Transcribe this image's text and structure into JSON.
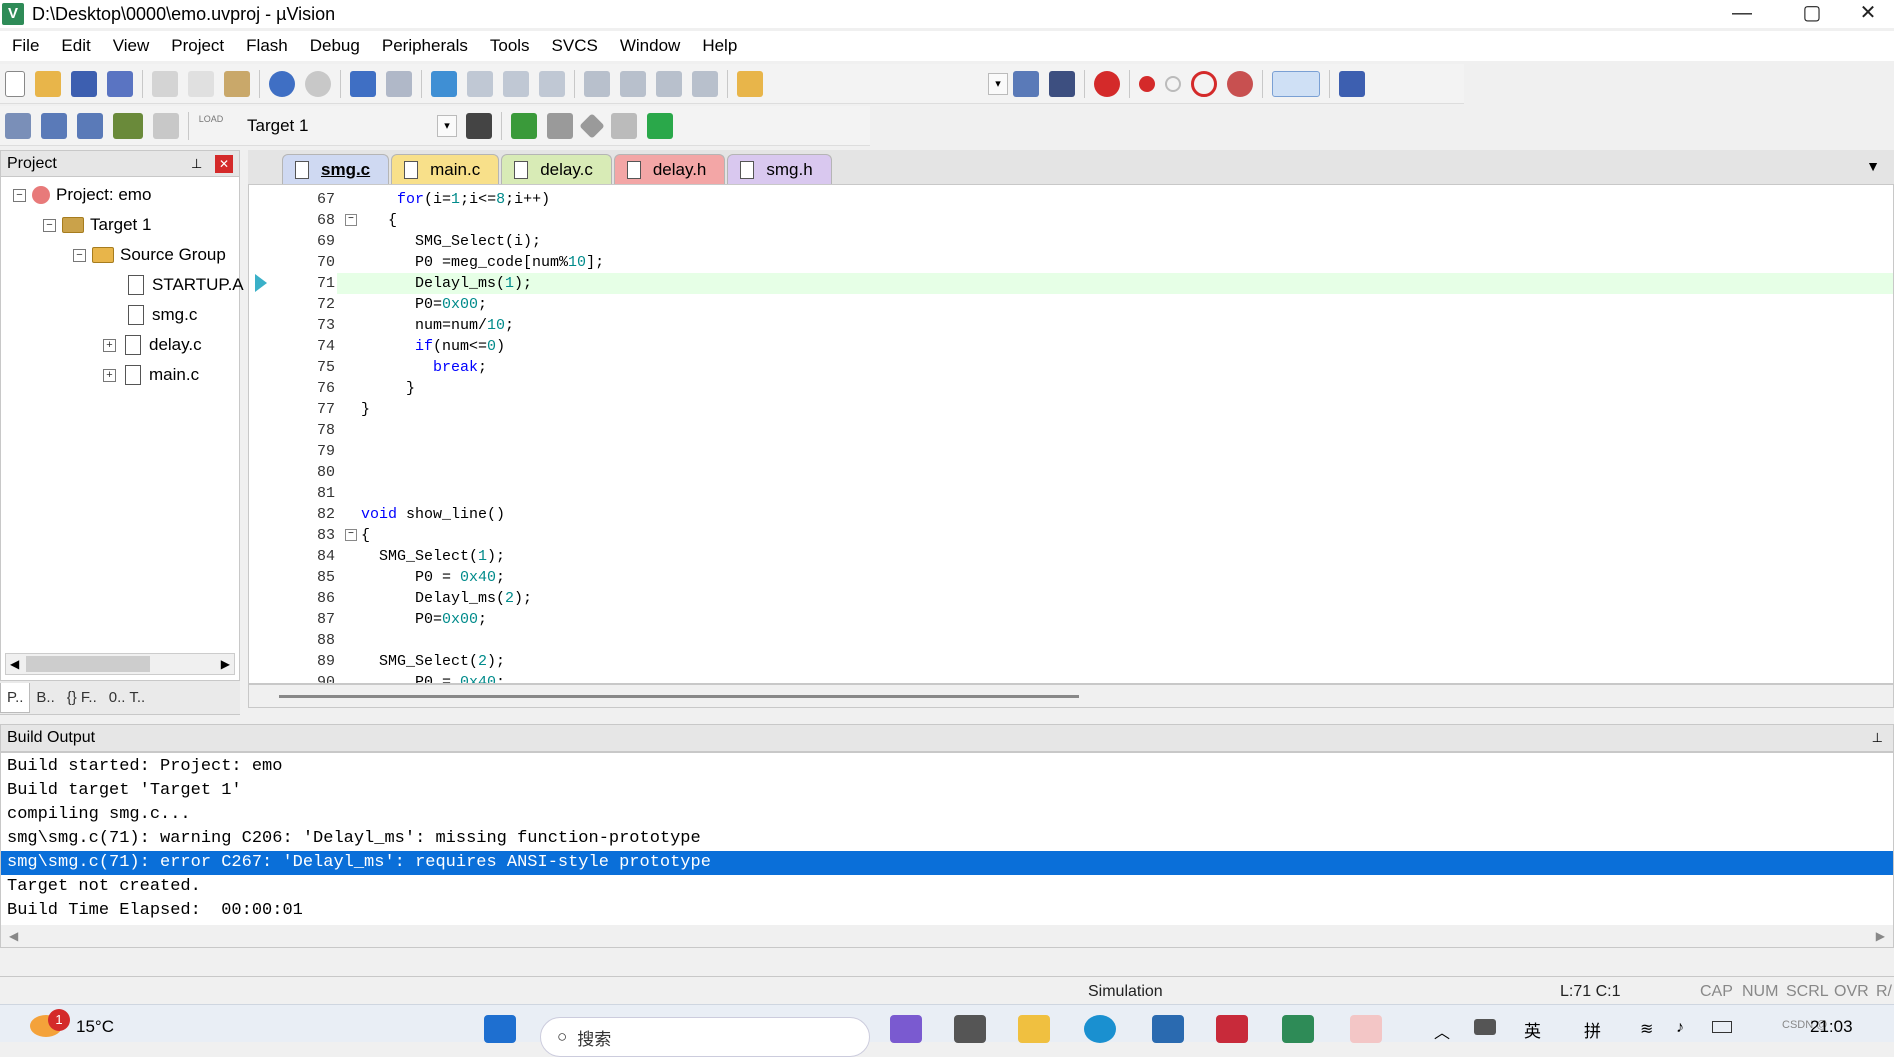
{
  "window": {
    "title": "D:\\Desktop\\0000\\emo.uvproj - µVision",
    "app_icon_letter": "V",
    "controls": {
      "minimize": "—",
      "maximize": "▢",
      "close": "✕"
    }
  },
  "menu": [
    "File",
    "Edit",
    "View",
    "Project",
    "Flash",
    "Debug",
    "Peripherals",
    "Tools",
    "SVCS",
    "Window",
    "Help"
  ],
  "toolbar2": {
    "target_combo": "Target 1",
    "load_label": "LOAD"
  },
  "project_panel": {
    "title": "Project",
    "pin": "📌",
    "close": "✕",
    "tree": {
      "project": "Project: emo",
      "target": "Target 1",
      "group": "Source Group",
      "files": [
        "STARTUP.A",
        "smg.c",
        "delay.c",
        "main.c"
      ]
    },
    "tabs": [
      "P..",
      "B..",
      "{} F..",
      "0.. T.."
    ]
  },
  "editor": {
    "tabs": [
      {
        "label": "smg.c",
        "color": "#cfd9f2"
      },
      {
        "label": "main.c",
        "color": "#f8e08a"
      },
      {
        "label": "delay.c",
        "color": "#d8ebb6"
      },
      {
        "label": "delay.h",
        "color": "#f3a6a6"
      },
      {
        "label": "smg.h",
        "color": "#d9c8ef"
      }
    ],
    "active_tab": "smg.c",
    "current_line": 71,
    "lines": [
      {
        "n": "67",
        "code": "    for(i=1;i<=8;i++)"
      },
      {
        "n": "68",
        "code": "   {"
      },
      {
        "n": "69",
        "code": "      SMG_Select(i);"
      },
      {
        "n": "70",
        "code": "      P0 =meg_code[num%10];"
      },
      {
        "n": "71",
        "code": "      Delayl_ms(1);"
      },
      {
        "n": "72",
        "code": "      P0=0x00;"
      },
      {
        "n": "73",
        "code": "      num=num/10;"
      },
      {
        "n": "74",
        "code": "      if(num<=0)"
      },
      {
        "n": "75",
        "code": "        break;"
      },
      {
        "n": "76",
        "code": "     }"
      },
      {
        "n": "77",
        "code": "}"
      },
      {
        "n": "78",
        "code": ""
      },
      {
        "n": "79",
        "code": ""
      },
      {
        "n": "80",
        "code": ""
      },
      {
        "n": "81",
        "code": ""
      },
      {
        "n": "82",
        "code": "void show_line()"
      },
      {
        "n": "83",
        "code": "{"
      },
      {
        "n": "84",
        "code": "  SMG_Select(1);"
      },
      {
        "n": "85",
        "code": "      P0 = 0x40;"
      },
      {
        "n": "86",
        "code": "      Delayl_ms(2);"
      },
      {
        "n": "87",
        "code": "      P0=0x00;"
      },
      {
        "n": "88",
        "code": ""
      },
      {
        "n": "89",
        "code": "  SMG_Select(2);"
      },
      {
        "n": "90",
        "code": "      P0 = 0x40;"
      }
    ]
  },
  "build_output": {
    "title": "Build Output",
    "pin": "📌",
    "lines": [
      "Build started: Project: emo",
      "Build target 'Target 1'",
      "compiling smg.c...",
      "smg\\smg.c(71): warning C206: 'Delayl_ms': missing function-prototype",
      "smg\\smg.c(71): error C267: 'Delayl_ms': requires ANSI-style prototype",
      "Target not created.",
      "Build Time Elapsed:  00:00:01"
    ],
    "selected_index": 4
  },
  "statusbar": {
    "mode": "Simulation",
    "position": "L:71 C:1",
    "indicators": [
      "CAP",
      "NUM",
      "SCRL",
      "OVR",
      "R/"
    ]
  },
  "taskbar": {
    "weather_temp": "15°C",
    "badge_count": "1",
    "search_placeholder": "搜索",
    "ime": [
      "英",
      "拼"
    ],
    "clock": "21:03",
    "watermark": "CSDN @"
  }
}
